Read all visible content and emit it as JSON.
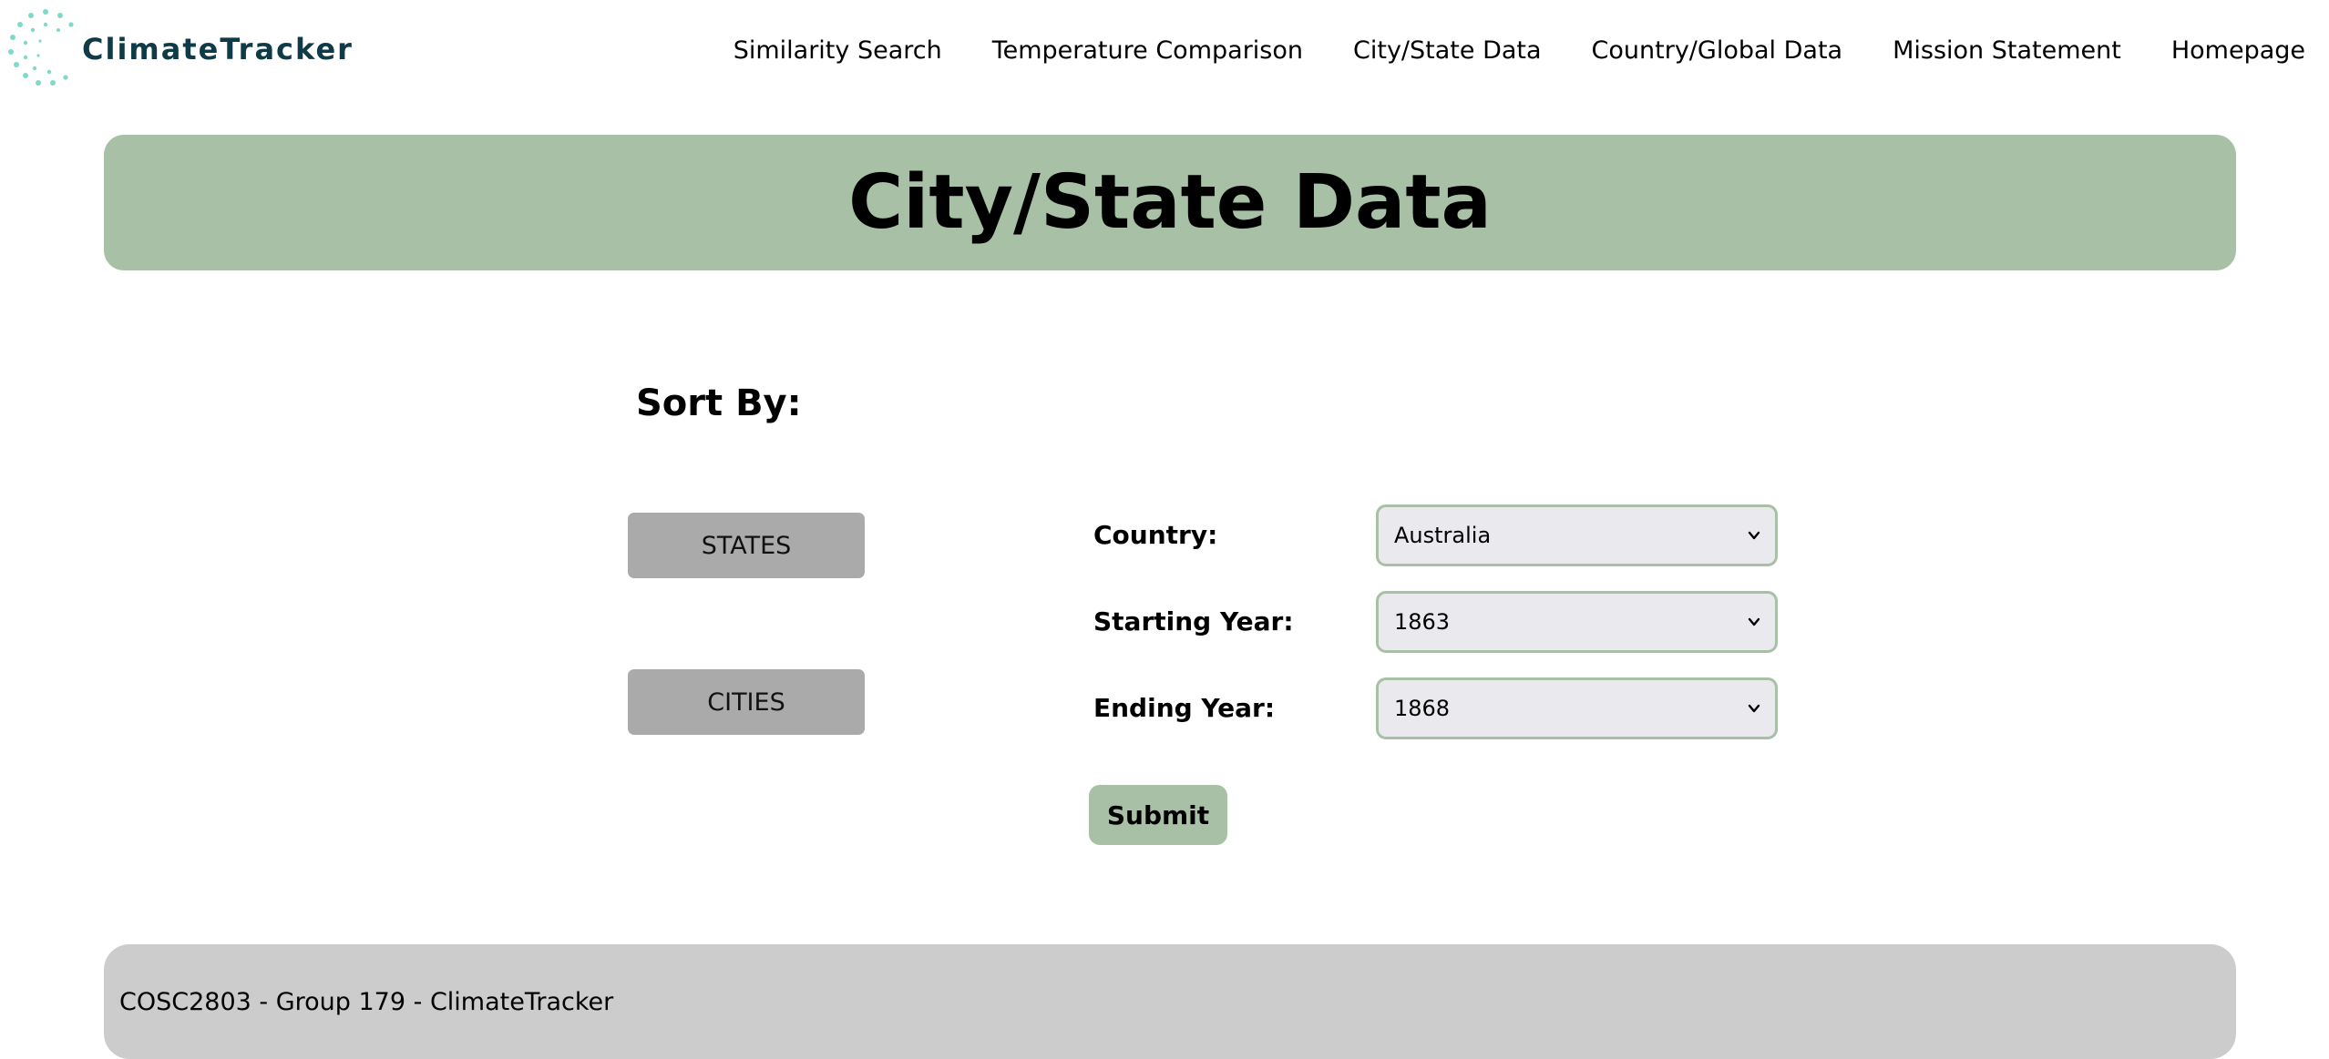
{
  "brand": {
    "name": "ClimateTracker",
    "text_color": "#0f3a48",
    "accent_color": "#7fd9c9"
  },
  "nav": {
    "links": [
      {
        "label": "Similarity Search"
      },
      {
        "label": "Temperature Comparison"
      },
      {
        "label": "City/State Data"
      },
      {
        "label": "Country/Global Data"
      },
      {
        "label": "Mission Statement"
      },
      {
        "label": "Homepage"
      }
    ]
  },
  "banner": {
    "title": "City/State Data",
    "color": "#a8c0a5"
  },
  "sort": {
    "heading": "Sort By:",
    "states_label": "STATES",
    "cities_label": "CITIES"
  },
  "form": {
    "country_label": "Country:",
    "country_value": "Australia",
    "start_label": "Starting Year:",
    "start_value": "1863",
    "end_label": "Ending Year:",
    "end_value": "1868",
    "submit_label": "Submit"
  },
  "footer": {
    "text": "COSC2803 - Group 179 - ClimateTracker"
  }
}
